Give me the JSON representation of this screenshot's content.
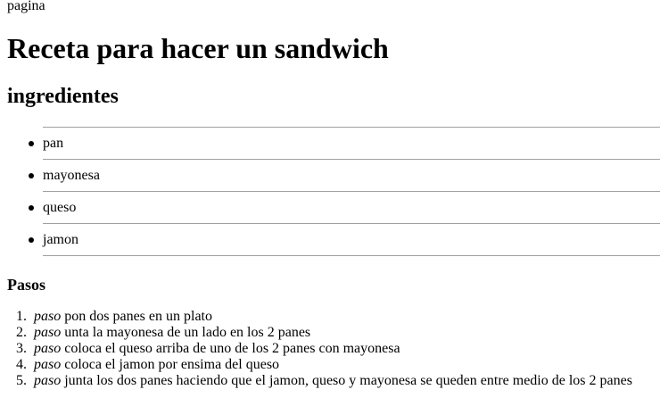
{
  "page_label": "pagina",
  "title": "Receta para hacer un sandwich",
  "ingredients": {
    "heading": "ingredientes",
    "items": [
      "pan",
      "mayonesa",
      "queso",
      "jamon"
    ]
  },
  "steps": {
    "heading": "Pasos",
    "items": [
      {
        "number": "1.",
        "label": "paso",
        "text": "pon dos panes en un plato"
      },
      {
        "number": "2.",
        "label": "paso",
        "text": "unta la mayonesa de un lado en los 2 panes"
      },
      {
        "number": "3.",
        "label": "paso",
        "text": "coloca el queso arriba de uno de los 2 panes con mayonesa"
      },
      {
        "number": "4.",
        "label": "paso",
        "text": "coloca el jamon por ensima del queso"
      },
      {
        "number": "5.",
        "label": "paso",
        "text": "junta los dos panes haciendo que el jamon, queso y mayonesa se queden entre medio de los 2 panes"
      }
    ]
  }
}
